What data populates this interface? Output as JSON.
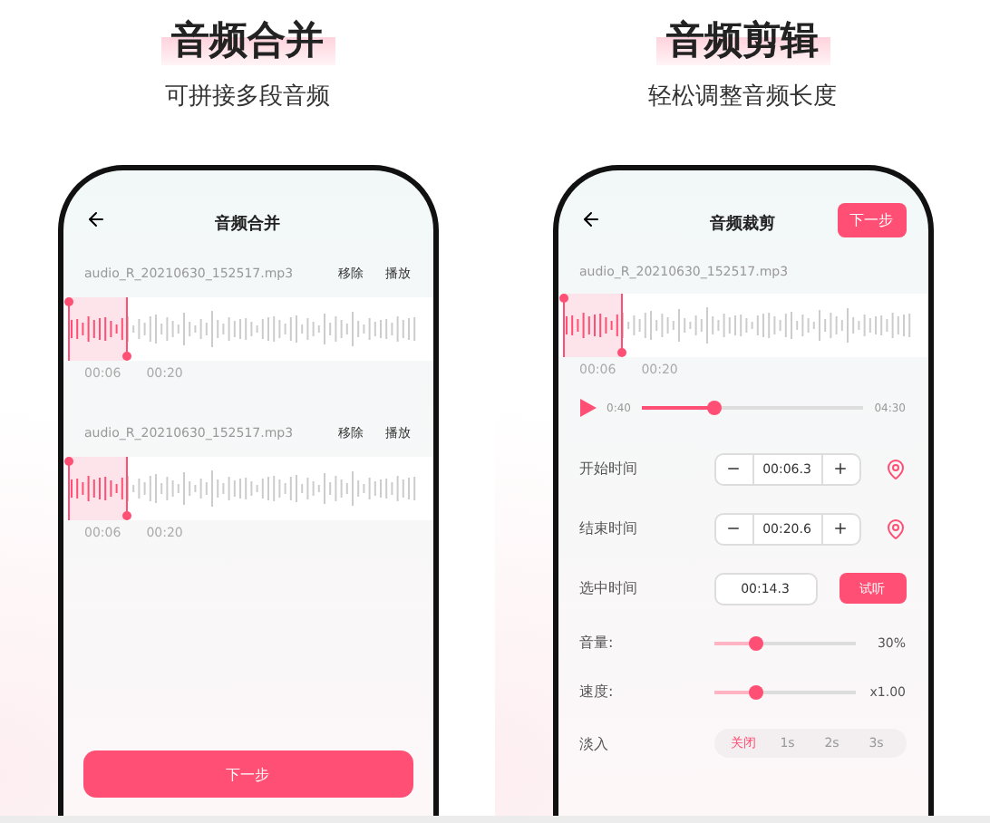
{
  "panels": [
    {
      "kind": "merge",
      "heading": "音频合并",
      "subheading": "可拼接多段音频",
      "screen": {
        "title": "音频合并",
        "tracks": [
          {
            "file": "audio_R_20210630_152517.mp3",
            "actions": [
              "移除",
              "播放"
            ],
            "start": "00:06",
            "end": "00:20"
          },
          {
            "file": "audio_R_20210630_152517.mp3",
            "actions": [
              "移除",
              "播放"
            ],
            "start": "00:06",
            "end": "00:20"
          }
        ],
        "next_button": "下一步"
      }
    },
    {
      "kind": "trim",
      "heading": "音频剪辑",
      "subheading": "轻松调整音频长度",
      "screen": {
        "title": "音频裁剪",
        "next_button": "下一步",
        "track": {
          "file": "audio_R_20210630_152517.mp3",
          "start": "00:06",
          "end": "00:20"
        },
        "player": {
          "current": "0:40",
          "total": "04:30",
          "level": 0.33
        },
        "rows": [
          {
            "kind": "stepper",
            "label": "开始时间",
            "value": "00:06.3"
          },
          {
            "kind": "stepper",
            "label": "结束时间",
            "value": "00:20.6"
          },
          {
            "kind": "field",
            "label": "选中时间",
            "value": "00:14.3",
            "button": "试听"
          },
          {
            "kind": "slider",
            "label": "音量:",
            "level": 0.3,
            "reading": "30%"
          },
          {
            "kind": "slider",
            "label": "速度:",
            "level": 0.3,
            "reading": "x1.00"
          },
          {
            "kind": "segmented",
            "label": "淡入",
            "options": [
              {
                "label": "关闭",
                "selected": true
              },
              {
                "label": "1s",
                "selected": false
              },
              {
                "label": "2s",
                "selected": false
              },
              {
                "label": "3s",
                "selected": false
              }
            ]
          }
        ]
      }
    }
  ]
}
